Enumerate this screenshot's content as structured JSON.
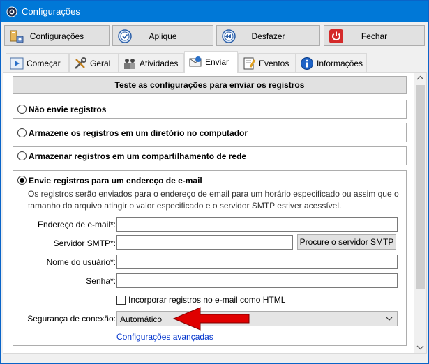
{
  "window": {
    "title": "Configurações"
  },
  "toolbar": {
    "configuracoes_label": "Configurações",
    "aplique_label": "Aplique",
    "desfazer_label": "Desfazer",
    "fechar_label": "Fechar"
  },
  "tabs": [
    {
      "label": "Começar",
      "icon": "play-icon"
    },
    {
      "label": "Geral",
      "icon": "tools-icon"
    },
    {
      "label": "Atividades",
      "icon": "people-icon"
    },
    {
      "label": "Enviar",
      "icon": "mail-icon",
      "active": true
    },
    {
      "label": "Eventos",
      "icon": "notepad-icon"
    },
    {
      "label": "Informações",
      "icon": "info-icon"
    }
  ],
  "content": {
    "test_button_label": "Teste as configurações para enviar os registros",
    "options": {
      "no_send": "Não envie registros",
      "store_dir": "Armazene os registros em um diretório no computador",
      "store_share": "Armazenar registros em um compartilhamento de rede",
      "send_email": "Envie registros para um endereço de e-mail"
    },
    "email": {
      "description": "Os registros serão enviados para o endereço de email para um horário especificado ou assim que o tamanho do arquivo atingir o valor especificado e o servidor SMTP estiver acessível.",
      "address_label": "Endereço de e-mail*:",
      "address_value": "",
      "smtp_label": "Servidor SMTP*:",
      "smtp_value": "",
      "smtp_button": "Procure o servidor SMTP",
      "user_label": "Nome do usuário*:",
      "user_value": "",
      "password_label": "Senha*:",
      "password_value": "",
      "embed_html_label": "Incorporar registros no e-mail como HTML",
      "embed_html_checked": false,
      "security_label": "Segurança de conexão:",
      "security_value": "Automático",
      "advanced_link": "Configurações avançadas"
    }
  },
  "colors": {
    "titlebar": "#0078d7",
    "link": "#0033cc",
    "arrow": "#e00000"
  }
}
